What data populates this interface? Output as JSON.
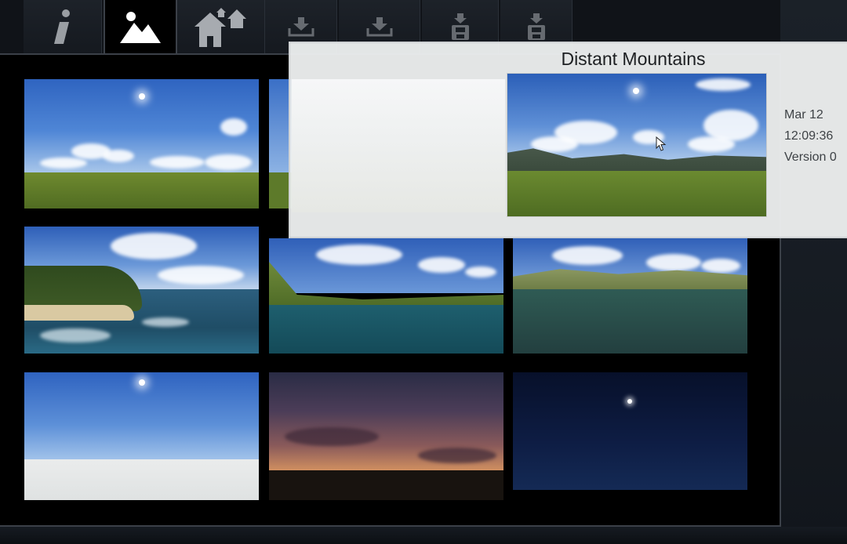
{
  "toolbar": {
    "tabs": [
      {
        "name": "info",
        "icon": "info-icon",
        "active": false
      },
      {
        "name": "skies",
        "icon": "mountain-image-icon",
        "active": true
      },
      {
        "name": "buildings",
        "icon": "houses-icon",
        "active": false
      },
      {
        "name": "import-1",
        "icon": "download-icon",
        "active": false
      },
      {
        "name": "import-2",
        "icon": "download-icon",
        "active": false
      },
      {
        "name": "save-1",
        "icon": "save-disk-icon",
        "active": false
      },
      {
        "name": "save-2",
        "icon": "save-disk-icon",
        "active": false
      }
    ]
  },
  "gallery": {
    "thumbnails": [
      {
        "name": "sunny-plains"
      },
      {
        "name": "distant-mountains"
      },
      {
        "name": "tropical-beach"
      },
      {
        "name": "mountain-lake"
      },
      {
        "name": "hillside-lake"
      },
      {
        "name": "clear-sky-white-ground"
      },
      {
        "name": "sunset"
      },
      {
        "name": "night-sky"
      }
    ]
  },
  "popup": {
    "title": "Distant Mountains",
    "date": "Mar 12",
    "time": "12:09:36",
    "version": "Version 0"
  },
  "colors": {
    "panel_bg": "#000000",
    "toolbar_bg": "#1a1f25",
    "popup_bg": "#eceeee",
    "sky_blue": "#3a6fc6",
    "grass_green": "#5d7a2a"
  }
}
